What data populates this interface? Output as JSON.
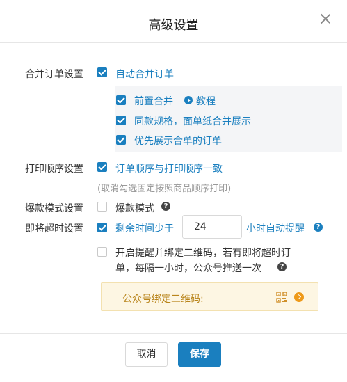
{
  "dialog": {
    "title": "高级设置"
  },
  "merge_order": {
    "label": "合并订单设置",
    "auto_merge": {
      "label": "自动合并订单",
      "checked": true
    },
    "options": [
      {
        "label": "前置合并",
        "checked": true,
        "tutorial_label": "教程"
      },
      {
        "label": "同款规格，面单纸合并展示",
        "checked": true
      },
      {
        "label": "优先展示合单的订单",
        "checked": true
      }
    ]
  },
  "print_order": {
    "label": "打印顺序设置",
    "option": {
      "label": "订单顺序与打印顺序一致",
      "checked": true
    },
    "note": "(取消勾选固定按照商品顺序打印)"
  },
  "hot_mode": {
    "label": "爆款模式设置",
    "option": {
      "label": "爆款模式",
      "checked": false
    }
  },
  "timeout": {
    "label": "即将超时设置",
    "option": {
      "label_before": "剩余时间少于",
      "value": "24",
      "label_after": "小时自动提醒",
      "checked": true
    },
    "bind_option": {
      "line1": "开启提醒并绑定二维码，若有即将超时订",
      "line2": "单，每隔一小时，公众号推送一次",
      "checked": false
    },
    "qr_label": "公众号绑定二维码:"
  },
  "footer": {
    "cancel_label": "取消",
    "save_label": "保存"
  },
  "colors": {
    "accent": "#1a7fbf",
    "warning_bg": "#fdf6e3",
    "warning_text": "#b9851c"
  }
}
